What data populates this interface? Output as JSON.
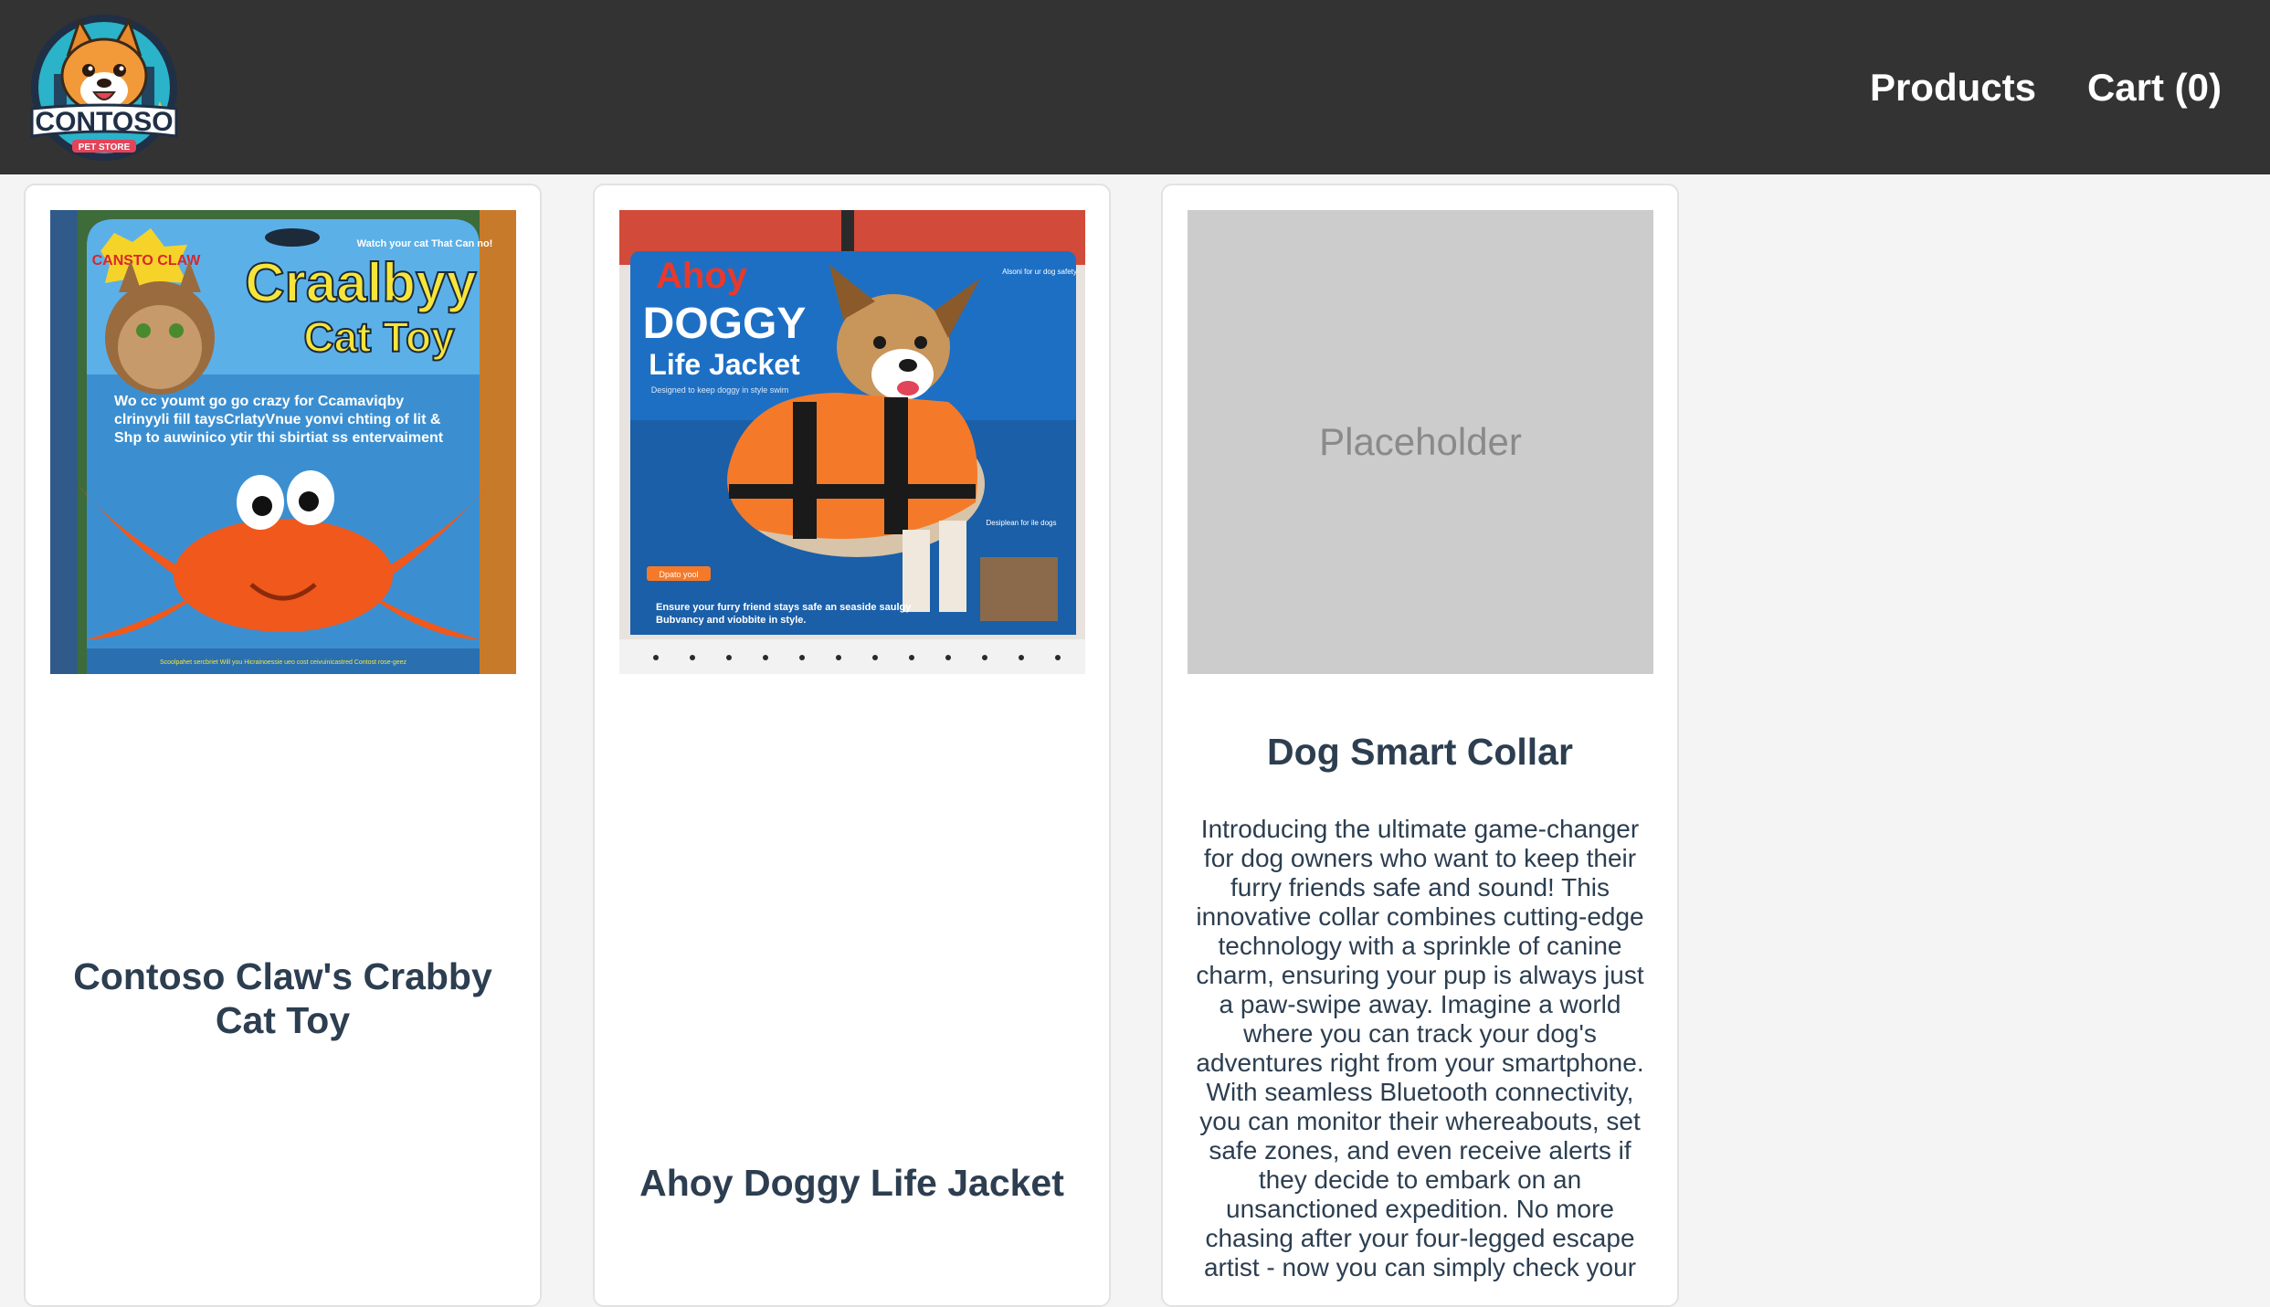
{
  "header": {
    "logo": {
      "name": "CONTOSO",
      "sub": "PET STORE"
    },
    "nav": [
      {
        "label": "Products"
      },
      {
        "label": "Cart (0)"
      }
    ]
  },
  "products": [
    {
      "title": "Contoso Claw's Crabby Cat Toy",
      "image": {
        "brand": "CANSTO CLAW",
        "headline1": "Craalbyy",
        "headline2": "Cat Toy",
        "corner": "Watch your cat That Can no!",
        "body": "Wo cc youmt go go crazy for Ccamaviqby clrinyyli fill taysCrlatyVnue yonvi chting of lit & Shp to auwinico ytir thi sbirtiat ss entervaiment",
        "footer": "Scoolpahet sercbriet Will you Hicrainoessie ueo cost ceivuinicastred Contost rose-geez"
      },
      "description": ""
    },
    {
      "title": "Ahoy Doggy Life Jacket",
      "image": {
        "brand": "Ahoy",
        "headline1": "DOGGY",
        "headline2": "Life Jacket",
        "tagline": "Designed to keep doggy in style swim",
        "side1": "Alsoni for ur dog safety",
        "side2": "Desiplean for ile dogs",
        "tag": "Dpato yool",
        "footer": "Ensure your furry friend stays safe an seaside saulgy Bubvancy and viobbite in style."
      },
      "description": ""
    },
    {
      "title": "Dog Smart Collar",
      "image": {
        "placeholder_text": "Placeholder"
      },
      "description": "Introducing the ultimate game-changer for dog owners who want to keep their furry friends safe and sound! This innovative collar combines cutting-edge technology with a sprinkle of canine charm, ensuring your pup is always just a paw-swipe away. Imagine a world where you can track your dog's adventures right from your smartphone. With seamless Bluetooth connectivity, you can monitor their whereabouts, set safe zones, and even receive alerts if they decide to embark on an unsanctioned expedition. No more chasing after your four-legged escape artist - now you can simply check your"
    }
  ],
  "colors": {
    "header_bg": "#333333",
    "page_bg": "#f4f4f4",
    "title_text": "#2c3e50",
    "placeholder_bg": "#cccccc"
  }
}
